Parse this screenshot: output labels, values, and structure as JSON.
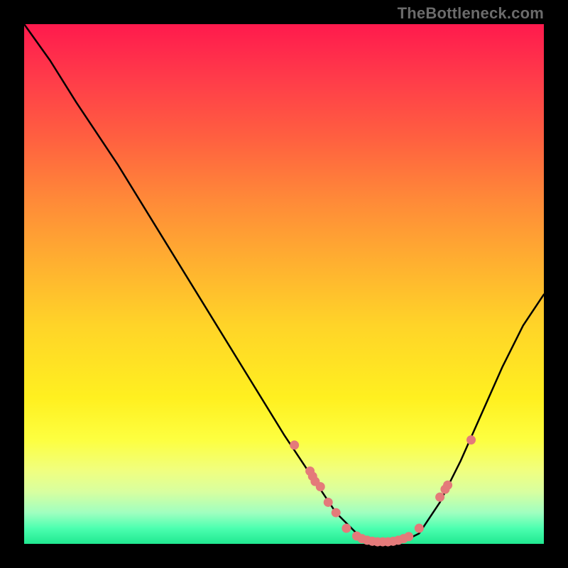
{
  "attribution": "TheBottleneck.com",
  "chart_data": {
    "type": "line",
    "title": "",
    "xlabel": "",
    "ylabel": "",
    "xlim": [
      0,
      100
    ],
    "ylim": [
      0,
      100
    ],
    "grid": false,
    "legend": false,
    "colors": {
      "gradient_top": "#ff1a4d",
      "gradient_bottom": "#20e890",
      "curve": "#000000",
      "marker": "#e47a7a"
    },
    "series": [
      {
        "name": "curve",
        "x": [
          0,
          5,
          10,
          18,
          26,
          34,
          42,
          50,
          56,
          60,
          64,
          68,
          72,
          76,
          80,
          84,
          88,
          92,
          96,
          100
        ],
        "y": [
          100,
          93,
          85,
          73,
          60,
          47,
          34,
          21,
          12,
          6,
          2,
          0,
          0,
          2,
          8,
          16,
          25,
          34,
          42,
          48
        ]
      }
    ],
    "markers": [
      {
        "x": 52,
        "y": 19
      },
      {
        "x": 55,
        "y": 14
      },
      {
        "x": 55.5,
        "y": 13
      },
      {
        "x": 56,
        "y": 12
      },
      {
        "x": 57,
        "y": 11
      },
      {
        "x": 58.5,
        "y": 8
      },
      {
        "x": 60,
        "y": 6
      },
      {
        "x": 62,
        "y": 3
      },
      {
        "x": 64,
        "y": 1.5
      },
      {
        "x": 65,
        "y": 1
      },
      {
        "x": 66,
        "y": 0.7
      },
      {
        "x": 67,
        "y": 0.5
      },
      {
        "x": 68,
        "y": 0.4
      },
      {
        "x": 69,
        "y": 0.4
      },
      {
        "x": 70,
        "y": 0.4
      },
      {
        "x": 71,
        "y": 0.5
      },
      {
        "x": 72,
        "y": 0.7
      },
      {
        "x": 73,
        "y": 1
      },
      {
        "x": 74,
        "y": 1.4
      },
      {
        "x": 76,
        "y": 3
      },
      {
        "x": 80,
        "y": 9
      },
      {
        "x": 81,
        "y": 10.5
      },
      {
        "x": 81.5,
        "y": 11.3
      },
      {
        "x": 86,
        "y": 20
      }
    ]
  }
}
